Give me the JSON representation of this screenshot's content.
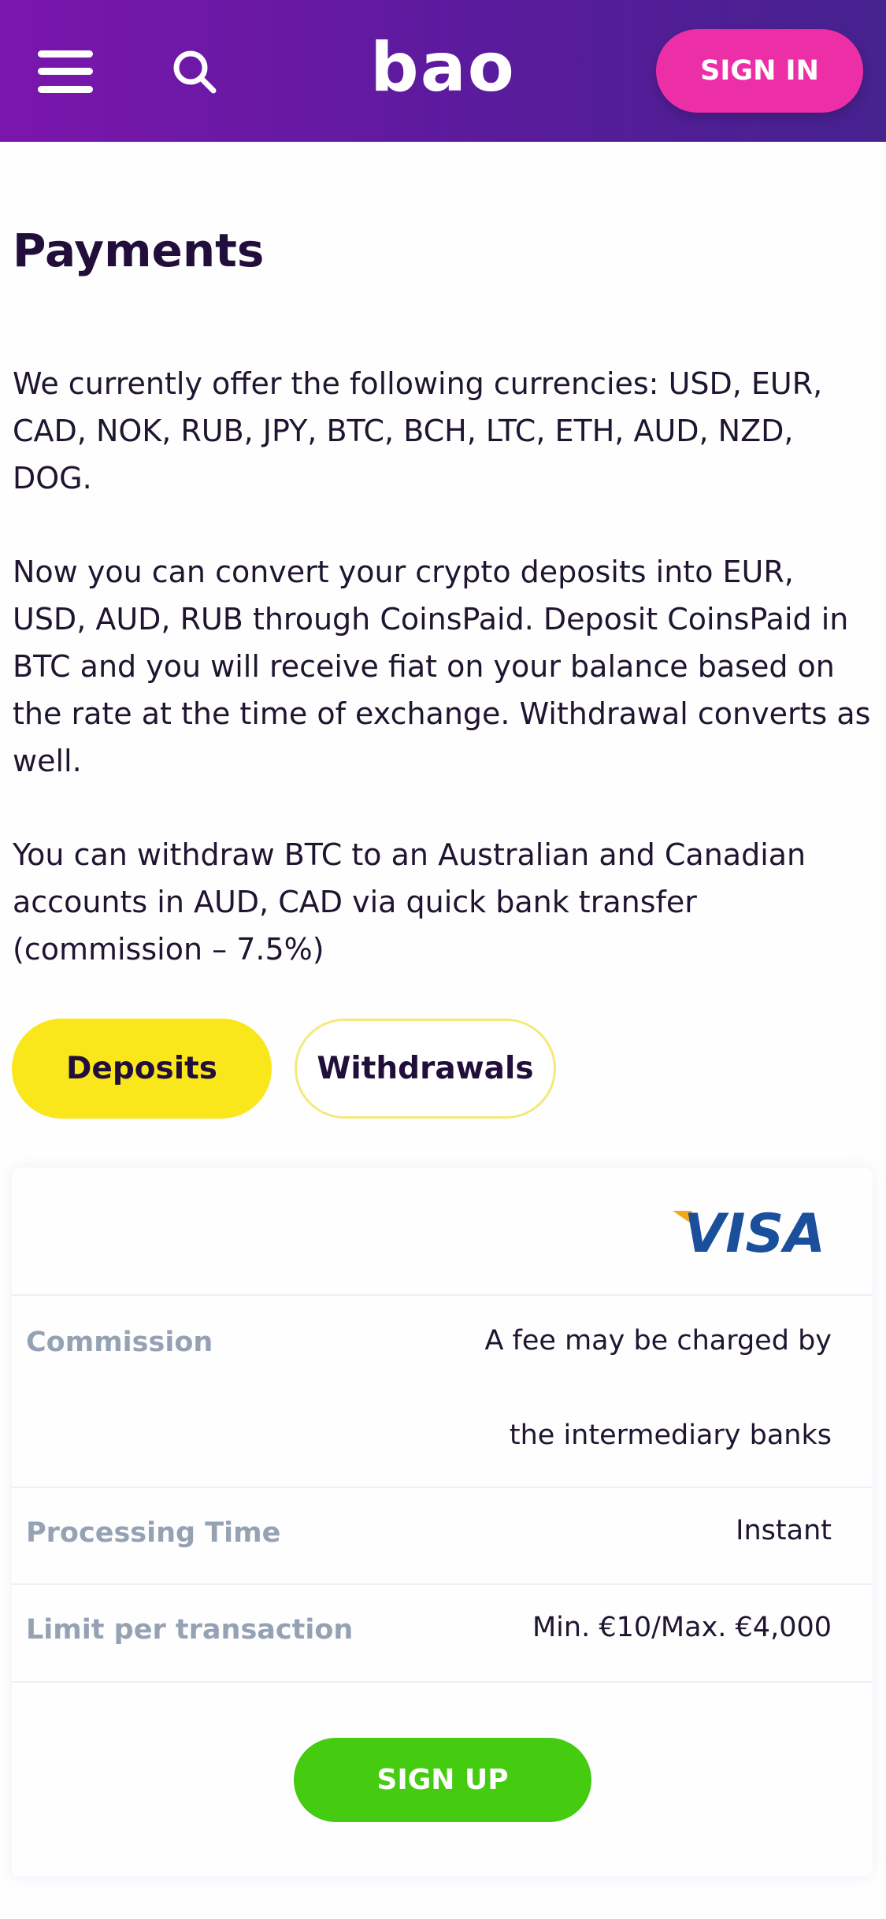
{
  "header": {
    "logo_text": "bao",
    "signin_label": "SIGN IN",
    "menu_icon": "hamburger-menu-icon",
    "search_icon": "search-icon",
    "colors": {
      "gradient_start": "#7b16ad",
      "gradient_end": "#46228f",
      "signin_bg": "#ec2fa6"
    }
  },
  "page": {
    "title": "Payments",
    "paragraphs": [
      "We currently offer the following currencies: USD, EUR, CAD, NOK, RUB, JPY, BTC, BCH, LTC, ETH, AUD, NZD, DOG.",
      "Now you can convert your crypto deposits into EUR, USD, AUD, RUB through CoinsPaid. Deposit CoinsPaid in BTC and you will receive fiat on your balance based on the rate at the time of exchange. Withdrawal converts as well.",
      "You can withdraw BTC to an Australian and Canadian accounts in AUD, CAD via quick bank transfer (commission – 7.5%)"
    ]
  },
  "tabs": {
    "deposits": "Deposits",
    "withdrawals": "Withdrawals",
    "active": "Deposits",
    "colors": {
      "active_bg": "#f9e71c",
      "inactive_border": "#f3ea7a"
    }
  },
  "method_card": {
    "logo_text": "VISA",
    "rows": [
      {
        "label": "Commission",
        "value_line1": "A fee may be charged by",
        "value_line2": "the intermediary banks"
      },
      {
        "label": "Processing Time",
        "value": "Instant"
      },
      {
        "label": "Limit per transaction",
        "value": "Min. €10/Max. €4,000"
      }
    ],
    "signup_label": "SIGN UP",
    "colors": {
      "signup_bg": "#45cb10",
      "visa_blue": "#1a4f9c",
      "visa_gold": "#f1a81c"
    }
  }
}
